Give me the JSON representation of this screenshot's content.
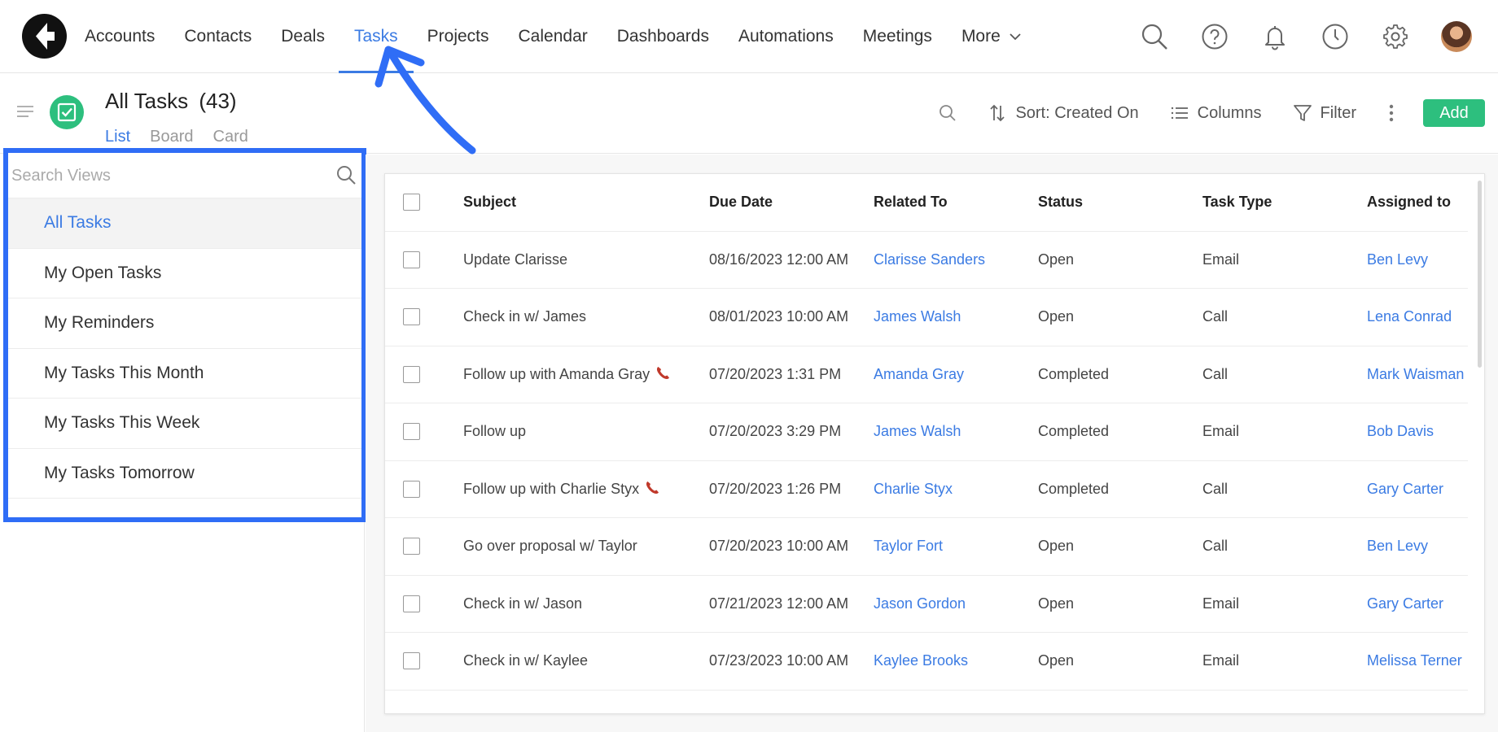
{
  "nav": {
    "items": [
      {
        "label": "Accounts"
      },
      {
        "label": "Contacts"
      },
      {
        "label": "Deals"
      },
      {
        "label": "Tasks"
      },
      {
        "label": "Projects"
      },
      {
        "label": "Calendar"
      },
      {
        "label": "Dashboards"
      },
      {
        "label": "Automations"
      },
      {
        "label": "Meetings"
      }
    ],
    "more_label": "More",
    "active": "Tasks",
    "icons": [
      "search-icon",
      "help-icon",
      "bell-icon",
      "clock-icon",
      "gear-icon",
      "avatar"
    ]
  },
  "header": {
    "title": "All Tasks",
    "count": "(43)",
    "view_tabs": [
      "List",
      "Board",
      "Card"
    ],
    "active_view": "List"
  },
  "toolbar": {
    "sort_label": "Sort: Created On",
    "columns_label": "Columns",
    "filter_label": "Filter",
    "add_label": "Add"
  },
  "views": {
    "search_placeholder": "Search Views",
    "items": [
      {
        "label": "All Tasks"
      },
      {
        "label": "My Open Tasks"
      },
      {
        "label": "My Reminders"
      },
      {
        "label": "My Tasks This Month"
      },
      {
        "label": "My Tasks This Week"
      },
      {
        "label": "My Tasks Tomorrow"
      }
    ],
    "active": "All Tasks"
  },
  "table": {
    "columns": [
      "Subject",
      "Due Date",
      "Related To",
      "Status",
      "Task Type",
      "Assigned to"
    ],
    "rows": [
      {
        "subject": "Update Clarisse",
        "due": "08/16/2023 12:00 AM",
        "related": "Clarisse Sanders",
        "status": "Open",
        "type": "Email",
        "assigned": "Ben Levy",
        "phone": false
      },
      {
        "subject": "Check in w/ James",
        "due": "08/01/2023 10:00 AM",
        "related": "James Walsh",
        "status": "Open",
        "type": "Call",
        "assigned": "Lena Conrad",
        "phone": false
      },
      {
        "subject": "Follow up with Amanda Gray",
        "due": "07/20/2023 1:31 PM",
        "related": "Amanda Gray",
        "status": "Completed",
        "type": "Call",
        "assigned": "Mark Waisman",
        "phone": true
      },
      {
        "subject": "Follow up",
        "due": "07/20/2023 3:29 PM",
        "related": "James Walsh",
        "status": "Completed",
        "type": "Email",
        "assigned": "Bob Davis",
        "phone": false
      },
      {
        "subject": "Follow up with Charlie Styx",
        "due": "07/20/2023 1:26 PM",
        "related": "Charlie Styx",
        "status": "Completed",
        "type": "Call",
        "assigned": "Gary Carter",
        "phone": true
      },
      {
        "subject": "Go over proposal w/ Taylor",
        "due": "07/20/2023 10:00 AM",
        "related": "Taylor Fort",
        "status": "Open",
        "type": "Call",
        "assigned": "Ben Levy",
        "phone": false
      },
      {
        "subject": "Check in w/ Jason",
        "due": "07/21/2023 12:00 AM",
        "related": "Jason Gordon",
        "status": "Open",
        "type": "Email",
        "assigned": "Gary Carter",
        "phone": false
      },
      {
        "subject": "Check in w/ Kaylee",
        "due": "07/23/2023 10:00 AM",
        "related": "Kaylee Brooks",
        "status": "Open",
        "type": "Email",
        "assigned": "Melissa Terner",
        "phone": false
      }
    ]
  },
  "colors": {
    "accent": "#3b7be3",
    "add_button": "#2dbf7e",
    "highlight_box": "#2f6df6",
    "phone_icon": "#c0392b"
  }
}
